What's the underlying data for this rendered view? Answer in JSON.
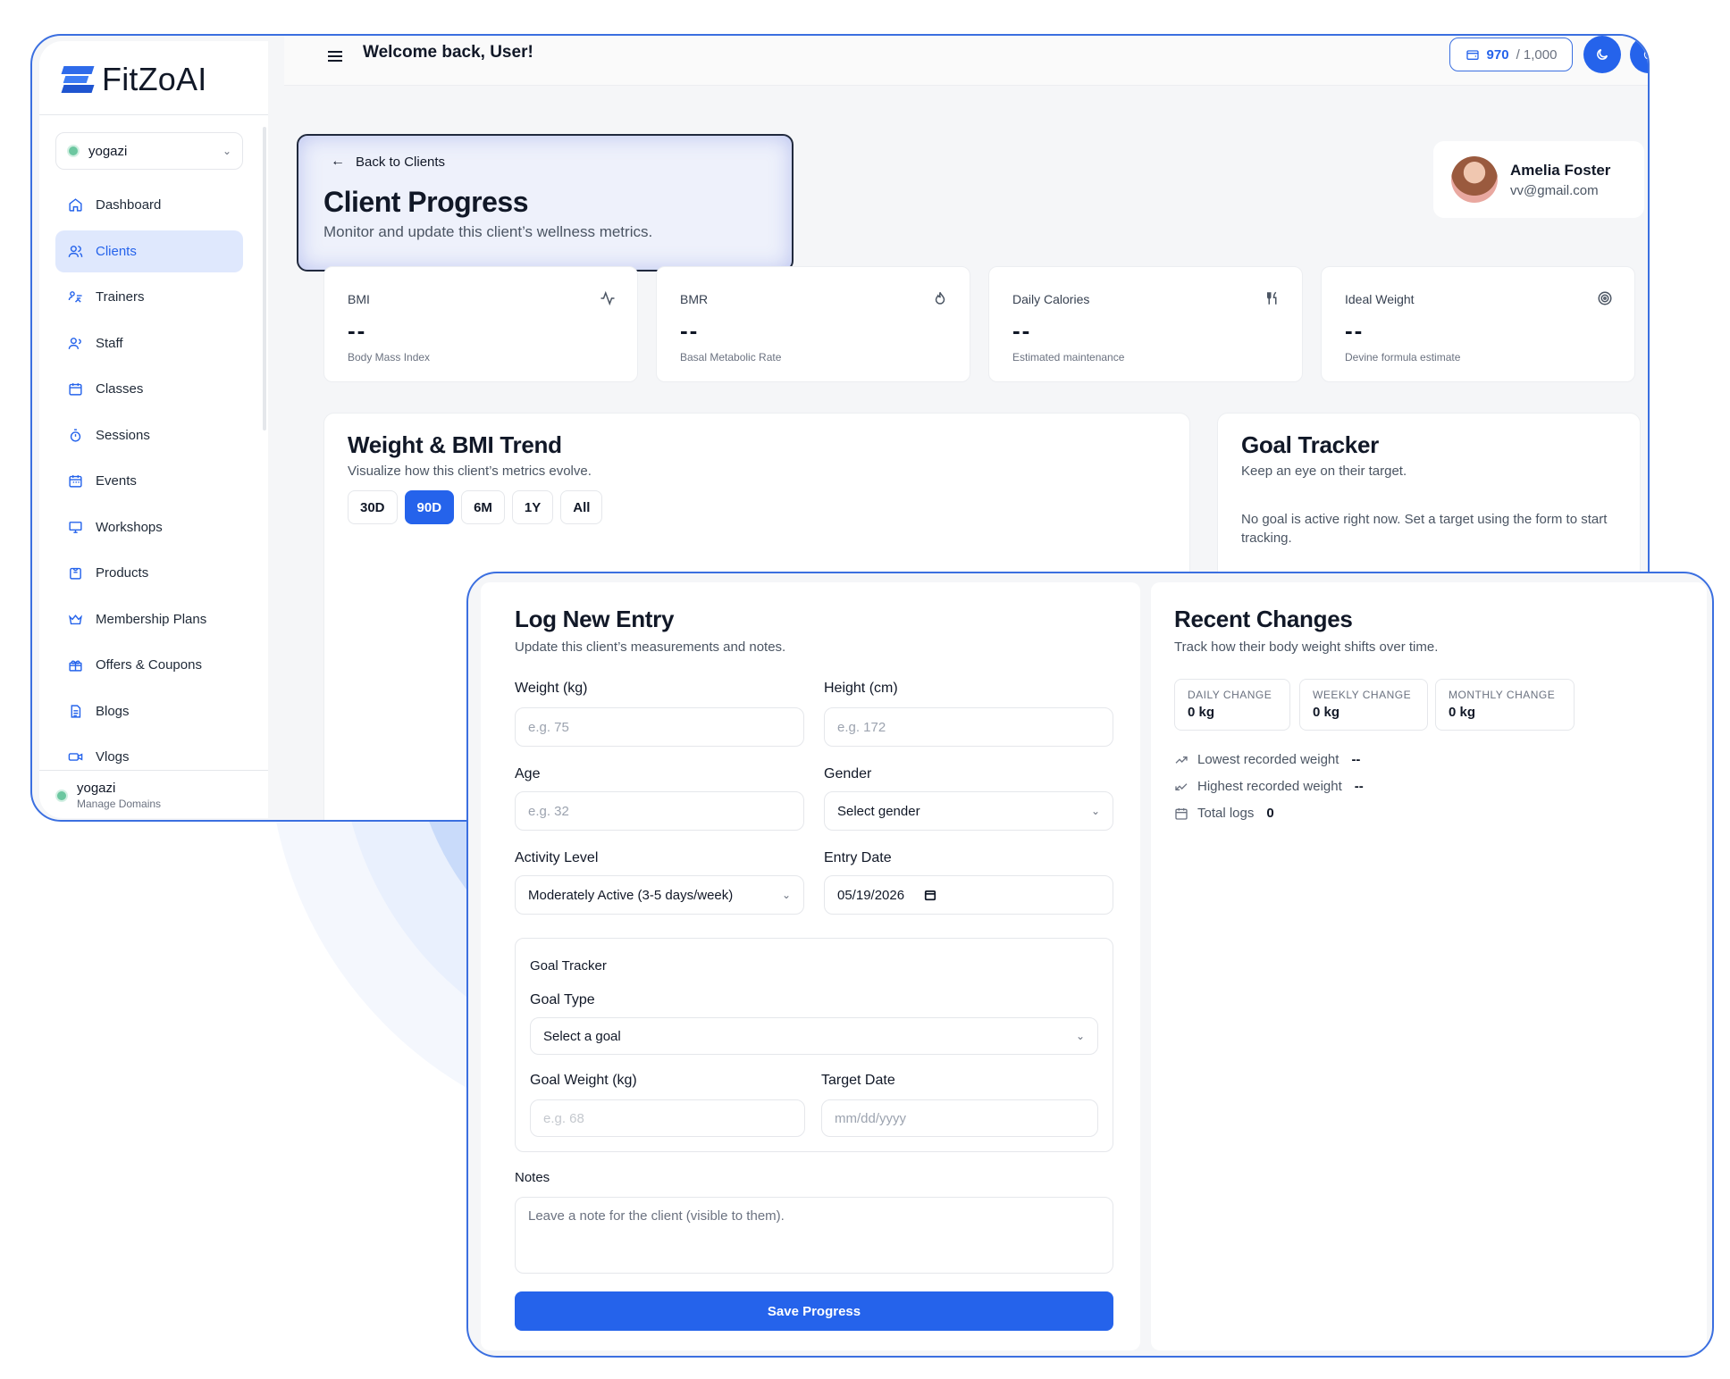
{
  "app": {
    "logo_text": "FitZoAI"
  },
  "sidebar": {
    "org": "yogazi",
    "items": [
      {
        "label": "Dashboard",
        "icon": "home-icon"
      },
      {
        "label": "Clients",
        "icon": "users-icon",
        "active": true
      },
      {
        "label": "Trainers",
        "icon": "trainer-icon"
      },
      {
        "label": "Staff",
        "icon": "staff-icon"
      },
      {
        "label": "Classes",
        "icon": "calendar-icon"
      },
      {
        "label": "Sessions",
        "icon": "timer-icon"
      },
      {
        "label": "Events",
        "icon": "calendar-icon"
      },
      {
        "label": "Workshops",
        "icon": "monitor-icon"
      },
      {
        "label": "Products",
        "icon": "box-icon"
      },
      {
        "label": "Membership Plans",
        "icon": "crown-icon"
      },
      {
        "label": "Offers & Coupons",
        "icon": "gift-icon"
      },
      {
        "label": "Blogs",
        "icon": "document-icon"
      },
      {
        "label": "Vlogs",
        "icon": "video-icon"
      }
    ],
    "footer": {
      "name": "yogazi",
      "sub": "Manage Domains"
    }
  },
  "topbar": {
    "welcome": "Welcome back, User!",
    "credits_value": "970",
    "credits_total": "/ 1,000"
  },
  "header": {
    "back_label": "Back to Clients",
    "title": "Client Progress",
    "subtitle": "Monitor and update this client’s wellness metrics."
  },
  "client": {
    "name": "Amelia Foster",
    "email": "vv@gmail.com"
  },
  "metrics": [
    {
      "label": "BMI",
      "value": "--",
      "sub": "Body Mass Index",
      "icon": "activity-icon"
    },
    {
      "label": "BMR",
      "value": "--",
      "sub": "Basal Metabolic Rate",
      "icon": "flame-icon"
    },
    {
      "label": "Daily Calories",
      "value": "--",
      "sub": "Estimated maintenance",
      "icon": "utensils-icon"
    },
    {
      "label": "Ideal Weight",
      "value": "--",
      "sub": "Devine formula estimate",
      "icon": "target-icon"
    }
  ],
  "trend": {
    "title": "Weight & BMI Trend",
    "subtitle": "Visualize how this client’s metrics evolve.",
    "ranges": [
      "30D",
      "90D",
      "6M",
      "1Y",
      "All"
    ],
    "active_range": "90D"
  },
  "goal": {
    "title": "Goal Tracker",
    "subtitle": "Keep an eye on their target.",
    "empty": "No goal is active right now. Set a target using the form to start tracking."
  },
  "log": {
    "title": "Log New Entry",
    "subtitle": "Update this client’s measurements and notes.",
    "weight_label": "Weight (kg)",
    "weight_placeholder": "e.g. 75",
    "height_label": "Height (cm)",
    "height_placeholder": "e.g. 172",
    "age_label": "Age",
    "age_placeholder": "e.g. 32",
    "gender_label": "Gender",
    "gender_value": "Select gender",
    "activity_label": "Activity Level",
    "activity_value": "Moderately Active (3-5 days/week)",
    "date_label": "Entry Date",
    "date_value": "05/19/2026",
    "goal_section": "Goal Tracker",
    "goal_type_label": "Goal Type",
    "goal_type_value": "Select a goal",
    "goal_weight_label": "Goal Weight (kg)",
    "goal_weight_placeholder": "e.g. 68",
    "target_date_label": "Target Date",
    "target_date_placeholder": "mm/dd/yyyy",
    "notes_label": "Notes",
    "notes_placeholder": "Leave a note for the client (visible to them).",
    "save_label": "Save Progress"
  },
  "recent": {
    "title": "Recent Changes",
    "subtitle": "Track how their body weight shifts over time.",
    "changes": [
      {
        "label": "DAILY CHANGE",
        "value": "0 kg"
      },
      {
        "label": "WEEKLY CHANGE",
        "value": "0 kg"
      },
      {
        "label": "MONTHLY CHANGE",
        "value": "0 kg"
      }
    ],
    "lowest_label": "Lowest recorded weight",
    "lowest_value": "--",
    "highest_label": "Highest recorded weight",
    "highest_value": "--",
    "logs_label": "Total logs",
    "logs_value": "0"
  }
}
